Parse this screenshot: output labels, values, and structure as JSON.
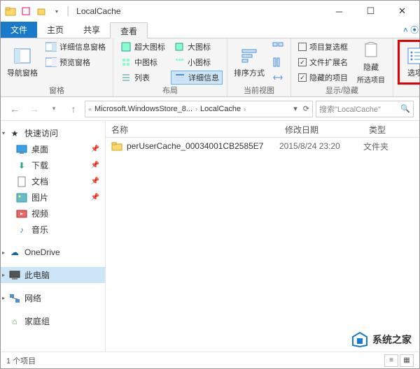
{
  "window": {
    "title": "LocalCache"
  },
  "tabs": {
    "file": "文件",
    "home": "主页",
    "share": "共享",
    "view": "查看"
  },
  "ribbon": {
    "panes": {
      "nav_pane": "导航窗格",
      "detail_pane": "详细信息窗格",
      "preview_pane": "预览窗格",
      "group_label": "窗格"
    },
    "layout": {
      "extra_large": "超大图标",
      "large": "大图标",
      "medium": "中图标",
      "small": "小图标",
      "list": "列表",
      "details": "详细信息",
      "group_label": "布局"
    },
    "current_view": {
      "sort": "排序方式",
      "group_label": "当前视图"
    },
    "show_hide": {
      "item_checkboxes": "项目复选框",
      "file_ext": "文件扩展名",
      "hidden_items": "隐藏的项目",
      "hide_selected": "隐藏",
      "hide_selected_sub": "所选项目",
      "group_label": "显示/隐藏"
    },
    "options": "选项"
  },
  "breadcrumb": {
    "seg1": "Microsoft.WindowsStore_8...",
    "seg2": "LocalCache"
  },
  "search": {
    "placeholder": "搜索\"LocalCache\""
  },
  "sidebar": {
    "quick_access": "快速访问",
    "desktop": "桌面",
    "downloads": "下载",
    "documents": "文档",
    "pictures": "图片",
    "videos": "视频",
    "music": "音乐",
    "onedrive": "OneDrive",
    "this_pc": "此电脑",
    "network": "网络",
    "homegroup": "家庭组"
  },
  "columns": {
    "name": "名称",
    "modified": "修改日期",
    "type": "类型"
  },
  "files": [
    {
      "name": "perUserCache_00034001CB2585E7",
      "date": "2015/8/24 23:20",
      "type": "文件夹"
    }
  ],
  "status": {
    "count": "1 个项目"
  },
  "watermark": "系统之家"
}
